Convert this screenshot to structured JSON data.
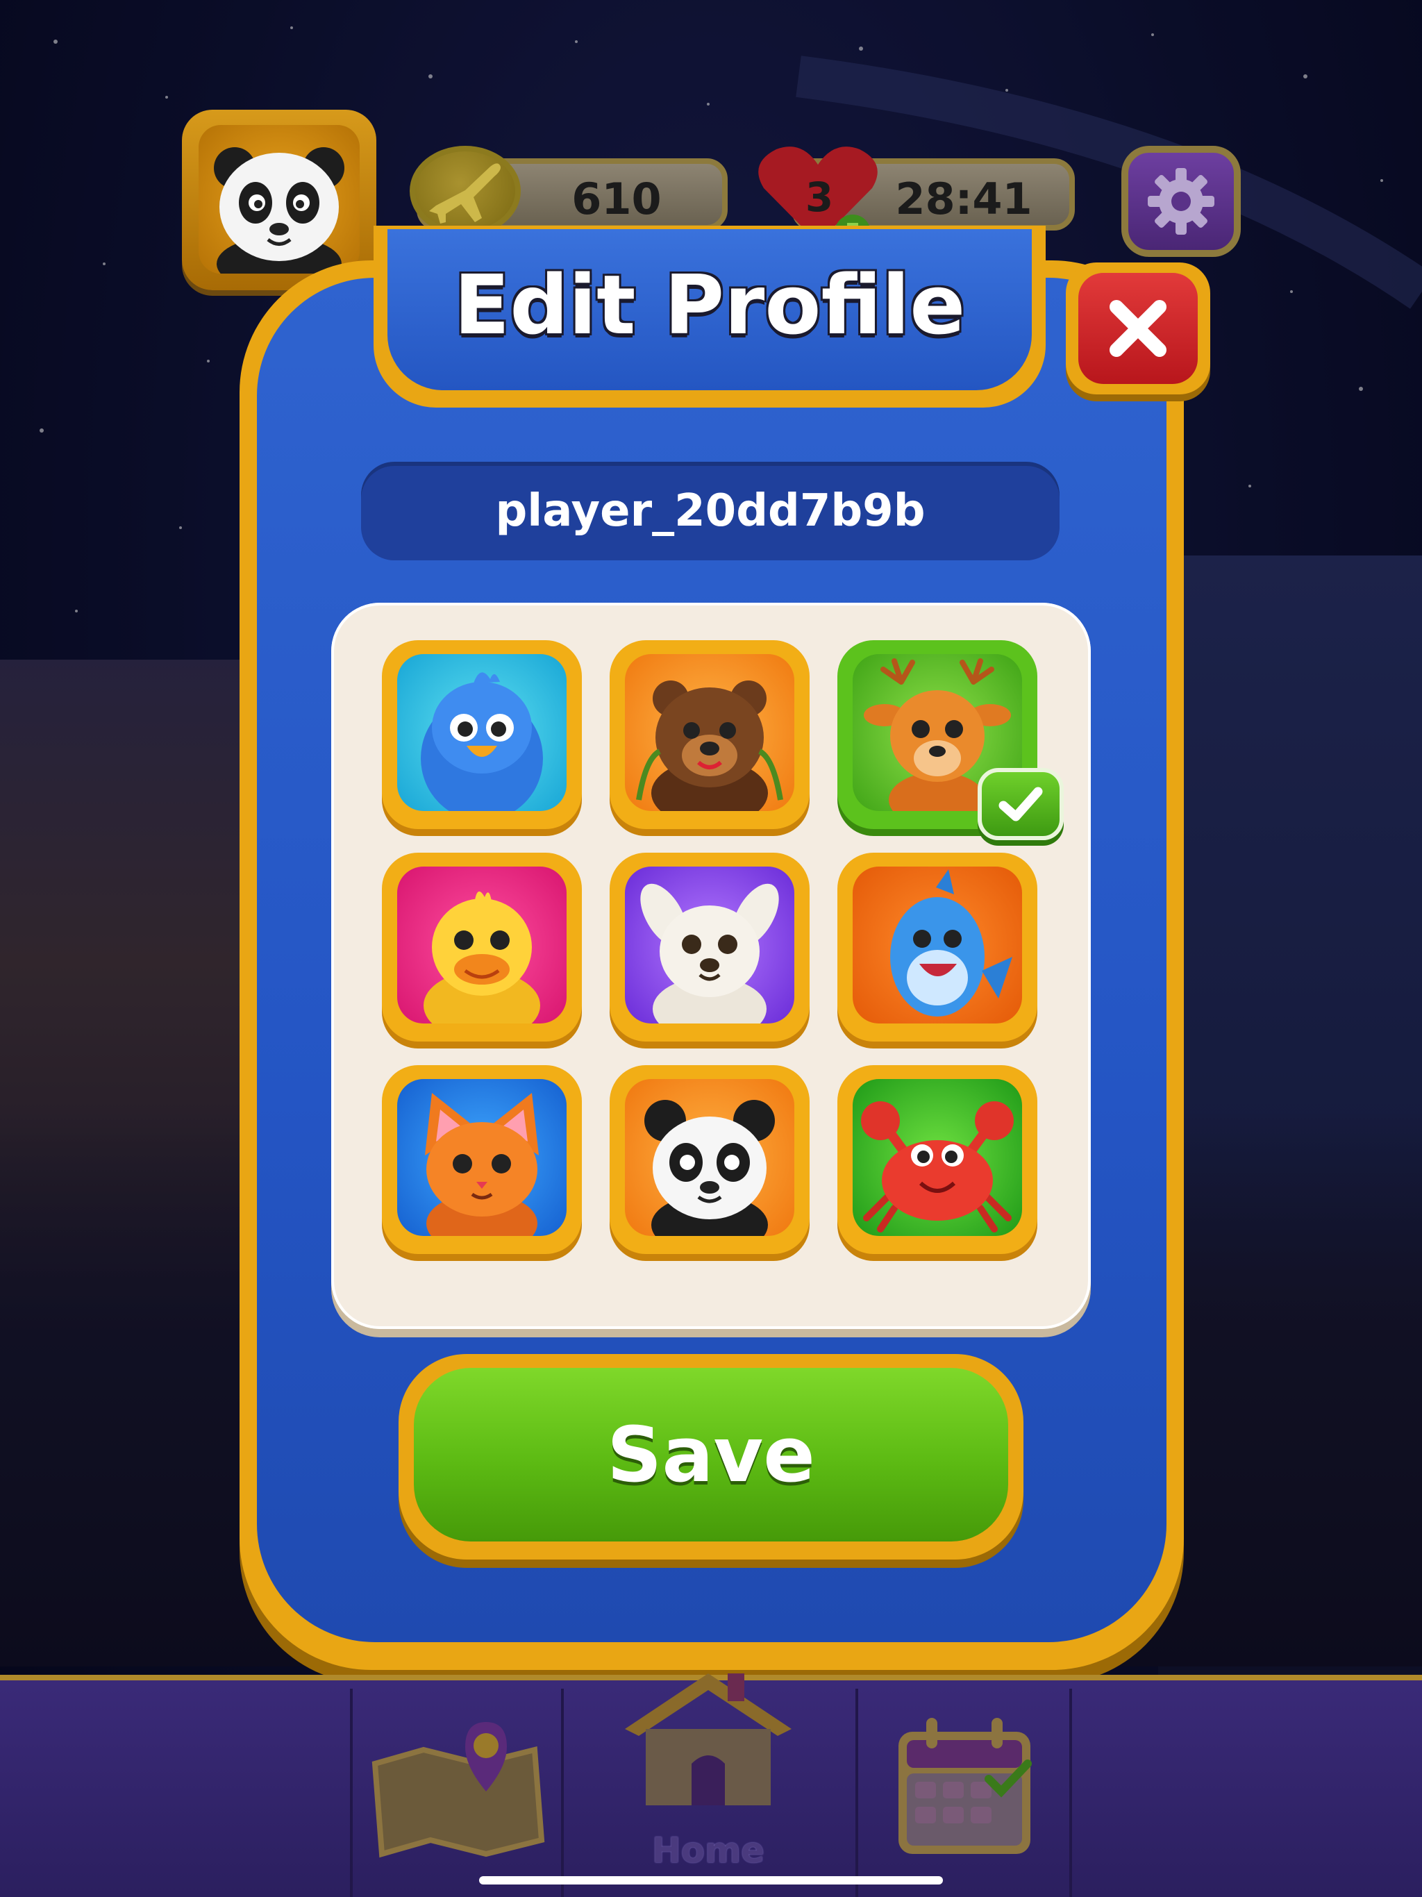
{
  "hud": {
    "coins": "610",
    "lives": "3",
    "timer": "28:41"
  },
  "modal": {
    "title": "Edit Profile",
    "username": "player_20dd7b9b",
    "save_label": "Save"
  },
  "avatars": [
    {
      "name": "blue-bird",
      "selected": false
    },
    {
      "name": "brown-bear",
      "selected": false
    },
    {
      "name": "deer",
      "selected": true
    },
    {
      "name": "yellow-duck",
      "selected": false
    },
    {
      "name": "white-bunny",
      "selected": false
    },
    {
      "name": "blue-dolphin",
      "selected": false
    },
    {
      "name": "orange-cat",
      "selected": false
    },
    {
      "name": "panda",
      "selected": false
    },
    {
      "name": "red-crab",
      "selected": false
    }
  ],
  "bottom_nav": {
    "items": [
      {
        "icon": "map-icon",
        "label": ""
      },
      {
        "icon": "home-icon",
        "label": "Home"
      },
      {
        "icon": "calendar-icon",
        "label": ""
      }
    ]
  },
  "colors": {
    "modal_blue": "#2455c4",
    "gold_border": "#e9a614",
    "save_green": "#5cba13",
    "close_red": "#d42b2f"
  }
}
